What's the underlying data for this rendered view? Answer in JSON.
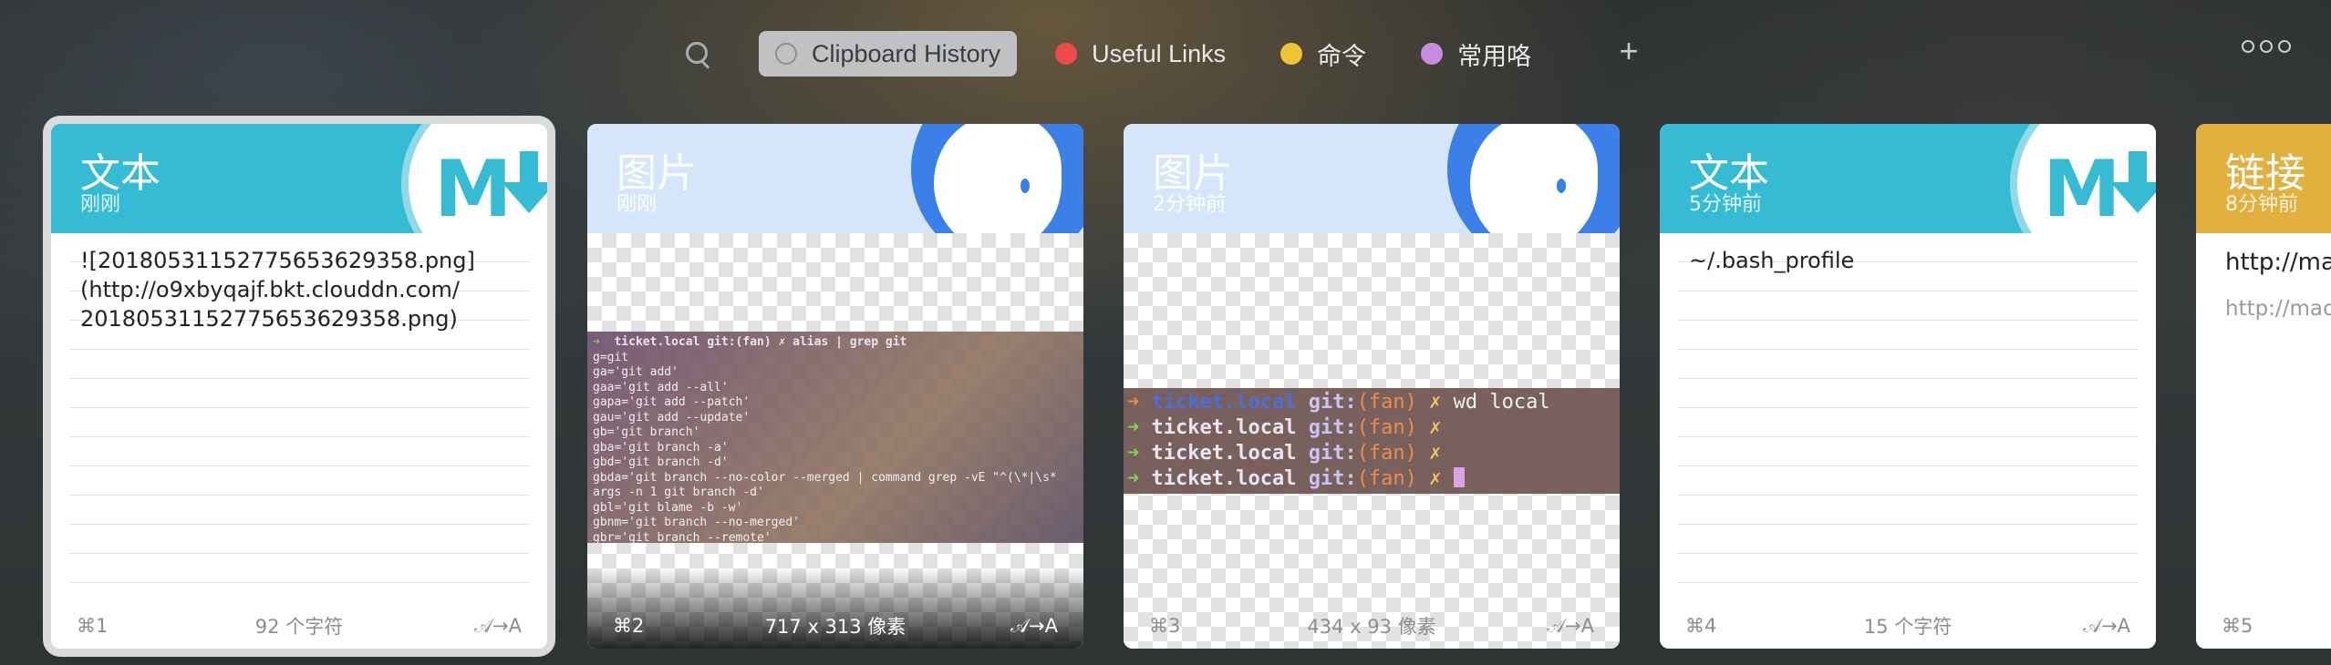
{
  "toolbar": {
    "tabs": [
      {
        "label": "Clipboard History",
        "color": "hollow"
      },
      {
        "label": "Useful Links",
        "color": "#ee4a4a"
      },
      {
        "label": "命令",
        "color": "#f3c135"
      },
      {
        "label": "常用咯",
        "color": "#c98be0"
      }
    ],
    "add_label": "+"
  },
  "cards": [
    {
      "type": "文本",
      "time": "刚刚",
      "content": "![20180531152775653629358.png]\n(http://o9xbyqajf.bkt.clouddn.com/\n20180531152775653629358.png)",
      "shortcut": "⌘1",
      "info": "92 个字符",
      "action": "𝒜→A",
      "badge": "M↓"
    },
    {
      "type": "图片",
      "time": "刚刚",
      "shortcut": "⌘2",
      "info": "717 x 313 像素",
      "action": "𝒜→A",
      "terminal_prompt": "ticket.local git:(fan) ✗ alias | grep git",
      "terminal_lines": [
        "g=git",
        "ga='git add'",
        "gaa='git add --all'",
        "gapa='git add --patch'",
        "gau='git add --update'",
        "gb='git branch'",
        "gba='git branch -a'",
        "gbd='git branch -d'",
        "gbda='git branch --no-color --merged | command grep -vE \"^(\\*|\\s*",
        "args -n 1 git branch -d'",
        "gbl='git blame -b -w'",
        "gbnm='git branch --no-merged'",
        "gbr='git branch --remote'"
      ]
    },
    {
      "type": "图片",
      "time": "2分钟前",
      "shortcut": "⌘3",
      "info": "434 x 93 像素",
      "action": "𝒜→A",
      "terminal": [
        {
          "host": "ticket.local",
          "git": "git:",
          "branch": "(fan)",
          "x": "✗",
          "cmd": "wd local"
        },
        {
          "host": "ticket.local",
          "git": "git:",
          "branch": "(fan)",
          "x": "✗",
          "cmd": ""
        },
        {
          "host": "ticket.local",
          "git": "git:",
          "branch": "(fan)",
          "x": "✗",
          "cmd": ""
        },
        {
          "host": "ticket.local",
          "git": "git:",
          "branch": "(fan)",
          "x": "✗",
          "cmd": ""
        }
      ]
    },
    {
      "type": "文本",
      "time": "5分钟前",
      "content": "~/.bash_profile",
      "shortcut": "⌘4",
      "info": "15 个字符",
      "action": "𝒜→A",
      "badge": "M↓"
    },
    {
      "type": "链接",
      "time": "8分钟前",
      "content": "http://ma",
      "sub": "http://mac",
      "shortcut": "⌘5"
    }
  ]
}
